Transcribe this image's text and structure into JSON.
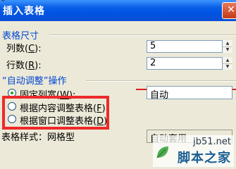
{
  "window": {
    "title": "插入表格",
    "top_mark": "↵"
  },
  "table_size": {
    "group_label": "表格尺寸",
    "columns_label": "列数",
    "columns_key": "C",
    "columns_value": "5",
    "rows_label": "行数",
    "rows_key": "R",
    "rows_value": "2"
  },
  "autofit": {
    "group_label": "“自动调整”操作",
    "options": [
      {
        "label": "固定列宽",
        "key": "W",
        "selected": true
      },
      {
        "label": "根据内容调整表格",
        "key": "F",
        "selected": false
      },
      {
        "label": "根据窗口调整表格",
        "key": "D",
        "selected": false
      }
    ],
    "fixed_width_value": "自动"
  },
  "table_style": {
    "label": "表格样式：",
    "value": "网格型",
    "button_label": "自动套用"
  },
  "watermark": {
    "site": "jb51.net",
    "text": "脚本之家"
  },
  "colors": {
    "highlight": "#ee2a2a",
    "group_title": "#0046d5",
    "title_bar": "#0054e3"
  }
}
